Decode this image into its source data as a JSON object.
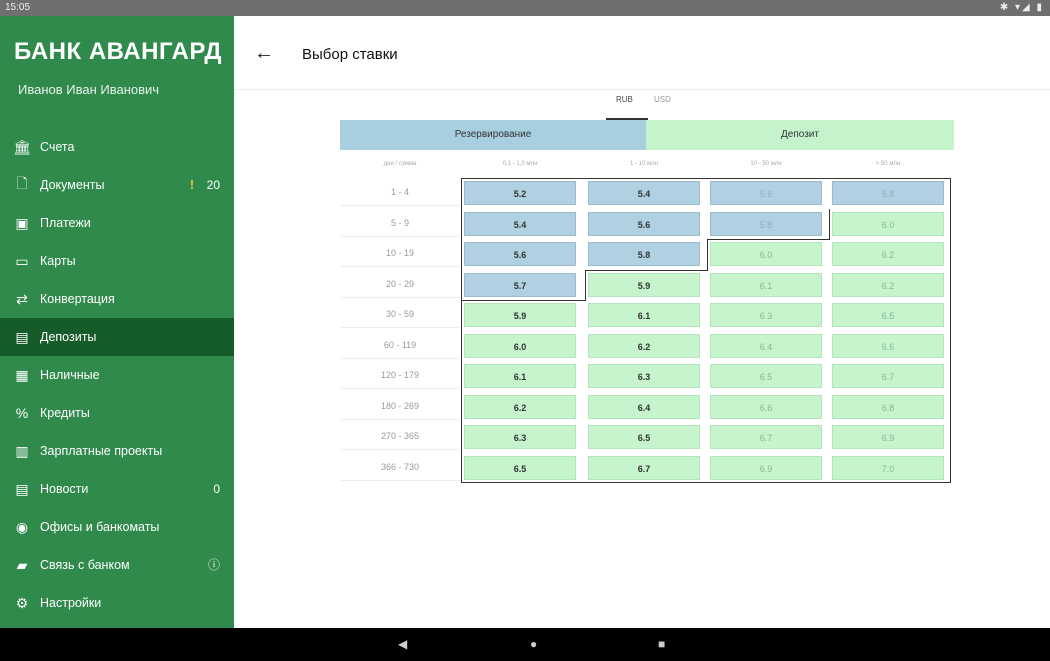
{
  "status": {
    "time": "15:05",
    "icons": "✱ ▾◢ ▮"
  },
  "sidebar": {
    "brand": "БАНК АВАНГАРД",
    "user": "Иванов Иван Иванович",
    "items": [
      {
        "label": "Счета",
        "icon": "bank-icon",
        "glyph": "🏛"
      },
      {
        "label": "Документы",
        "icon": "document-icon",
        "glyph": "🗋",
        "warn": "!",
        "badge": "20"
      },
      {
        "label": "Платежи",
        "icon": "payment-icon",
        "glyph": "▣"
      },
      {
        "label": "Карты",
        "icon": "card-icon",
        "glyph": "▭"
      },
      {
        "label": "Конвертация",
        "icon": "exchange-icon",
        "glyph": "⇄"
      },
      {
        "label": "Депозиты",
        "icon": "deposit-icon",
        "glyph": "▤",
        "active": true
      },
      {
        "label": "Наличные",
        "icon": "cash-icon",
        "glyph": "▦"
      },
      {
        "label": "Кредиты",
        "icon": "percent-icon",
        "glyph": "%"
      },
      {
        "label": "Зарплатные проекты",
        "icon": "salary-icon",
        "glyph": "▥"
      },
      {
        "label": "Новости",
        "icon": "news-icon",
        "glyph": "▤",
        "badge": "0"
      },
      {
        "label": "Офисы и банкоматы",
        "icon": "location-icon",
        "glyph": "◉"
      },
      {
        "label": "Связь с банком",
        "icon": "chat-icon",
        "glyph": "▰",
        "badge": "ⓘ"
      },
      {
        "label": "Настройки",
        "icon": "gear-icon",
        "glyph": "⚙"
      }
    ]
  },
  "header": {
    "title": "Выбор ставки",
    "back": "←"
  },
  "currency": {
    "rub": "RUB",
    "usd": "USD"
  },
  "table": {
    "groups": {
      "reserve": "Резервирование",
      "deposit": "Депозит"
    },
    "col_headers": [
      "дни / сумма",
      "0,1 - 1,0 млн",
      "1 - 10 млн",
      "10 - 50 млн",
      "> 50 млн"
    ],
    "rows": [
      {
        "label": "1 - 4",
        "values": [
          "5.2",
          "5.4",
          "5.6",
          "5.8"
        ],
        "reserve_cols": 4
      },
      {
        "label": "5 - 9",
        "values": [
          "5.4",
          "5.6",
          "5.8",
          "6.0"
        ],
        "reserve_cols": 3
      },
      {
        "label": "10 - 19",
        "values": [
          "5.6",
          "5.8",
          "6.0",
          "6.2"
        ],
        "reserve_cols": 2
      },
      {
        "label": "20 - 29",
        "values": [
          "5.7",
          "5.9",
          "6.1",
          "6.2"
        ],
        "reserve_cols": 1
      },
      {
        "label": "30 - 59",
        "values": [
          "5.9",
          "6.1",
          "6.3",
          "6.5"
        ],
        "reserve_cols": 0
      },
      {
        "label": "60 - 119",
        "values": [
          "6.0",
          "6.2",
          "6.4",
          "6.6"
        ],
        "reserve_cols": 0
      },
      {
        "label": "120 - 179",
        "values": [
          "6.1",
          "6.3",
          "6.5",
          "6.7"
        ],
        "reserve_cols": 0
      },
      {
        "label": "180 - 269",
        "values": [
          "6.2",
          "6.4",
          "6.6",
          "6.8"
        ],
        "reserve_cols": 0
      },
      {
        "label": "270 - 365",
        "values": [
          "6.3",
          "6.5",
          "6.7",
          "6.9"
        ],
        "reserve_cols": 0
      },
      {
        "label": "366 - 730",
        "values": [
          "6.5",
          "6.7",
          "6.9",
          "7.0"
        ],
        "reserve_cols": 0
      }
    ]
  },
  "nav": {
    "back": "◀",
    "home": "●",
    "recent": "■"
  }
}
